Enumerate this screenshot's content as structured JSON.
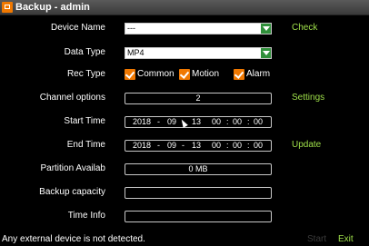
{
  "window": {
    "title": "Backup - admin"
  },
  "device": {
    "label": "Device Name",
    "value": "---",
    "check_label": "Check"
  },
  "data_type": {
    "label": "Data Type",
    "value": "MP4"
  },
  "rec_type": {
    "label": "Rec Type",
    "options": [
      {
        "label": "Common",
        "checked": true
      },
      {
        "label": "Motion",
        "checked": true
      },
      {
        "label": "Alarm",
        "checked": true
      }
    ]
  },
  "channel": {
    "label": "Channel options",
    "value": "2",
    "settings_label": "Settings"
  },
  "start_time": {
    "label": "Start Time",
    "year": "2018",
    "month": "09",
    "day": "13",
    "hour": "00",
    "minute": "00",
    "second": "00"
  },
  "end_time": {
    "label": "End Time",
    "year": "2018",
    "month": "09",
    "day": "13",
    "hour": "00",
    "minute": "00",
    "second": "00",
    "update_label": "Update"
  },
  "partition": {
    "label": "Partition Availab",
    "value": "0 MB"
  },
  "backup_capacity": {
    "label": "Backup capacity",
    "value": ""
  },
  "time_info": {
    "label": "Time Info",
    "value": ""
  },
  "footer": {
    "status": "Any external device is not detected.",
    "start_label": "Start",
    "exit_label": "Exit"
  },
  "colors": {
    "accent": "#f07800",
    "link": "#9fe04a",
    "dropdown": "#2f8f3a"
  }
}
